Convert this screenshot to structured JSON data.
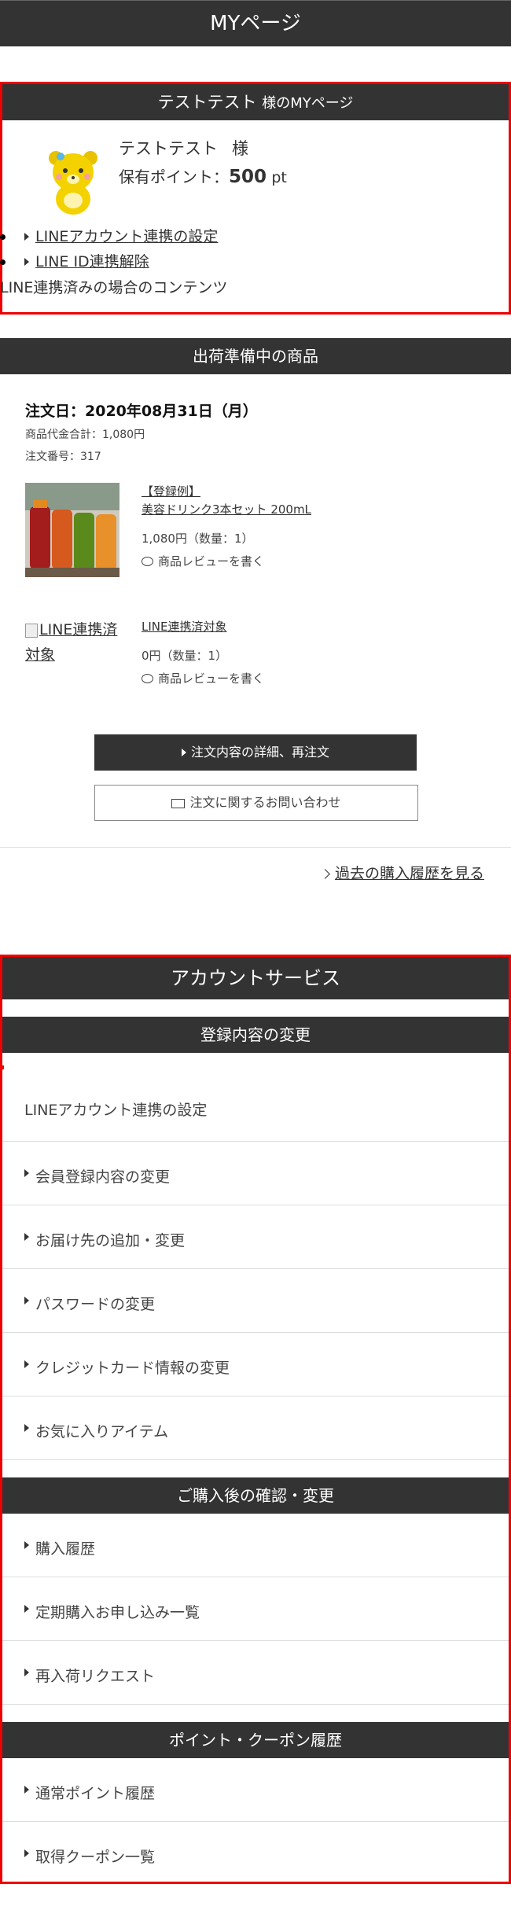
{
  "header": {
    "title": "MYページ"
  },
  "mypage": {
    "heading": "テストテスト",
    "heading_suffix": "様のMYページ",
    "user_name": "テストテスト",
    "user_honorific": "様",
    "points_label": "保有ポイント：",
    "points_value": "500",
    "points_unit": "pt",
    "links": [
      "LINEアカウント連携の設定",
      "LINE ID連携解除"
    ],
    "line_content": "LINE連携済みの場合のコンテンツ"
  },
  "shipping": {
    "title": "出荷準備中の商品",
    "order_date": "注文日：2020年08月31日（月）",
    "total": "商品代金合計：1,080円",
    "order_no": "注文番号：317",
    "items": [
      {
        "name_line1": "【登録例】",
        "name_line2": "美容ドリンク3本セット 200mL",
        "price": "1,080円（数量：1）",
        "review": "商品レビューを書く"
      },
      {
        "image_alt": "LINE連携済対象",
        "name_line1": "LINE連携済対象",
        "price": "0円（数量：1）",
        "review": "商品レビューを書く"
      }
    ],
    "detail_button": "注文内容の詳細、再注文",
    "contact_button": "注文に関するお問い合わせ",
    "history_link": "過去の購入履歴を見る"
  },
  "account": {
    "title": "アカウントサービス",
    "sections": [
      {
        "title": "登録内容の変更",
        "line_item": "LINEアカウント連携の設定",
        "items": [
          "会員登録内容の変更",
          "お届け先の追加・変更",
          "パスワードの変更",
          "クレジットカード情報の変更",
          "お気に入りアイテム"
        ]
      },
      {
        "title": "ご購入後の確認・変更",
        "items": [
          "購入履歴",
          "定期購入お申し込み一覧",
          "再入荷リクエスト"
        ]
      },
      {
        "title": "ポイント・クーポン履歴",
        "items": [
          "通常ポイント履歴",
          "取得クーポン一覧"
        ]
      }
    ]
  },
  "colors": {
    "dark_bar": "#333333",
    "highlight_border": "#ee0000"
  }
}
